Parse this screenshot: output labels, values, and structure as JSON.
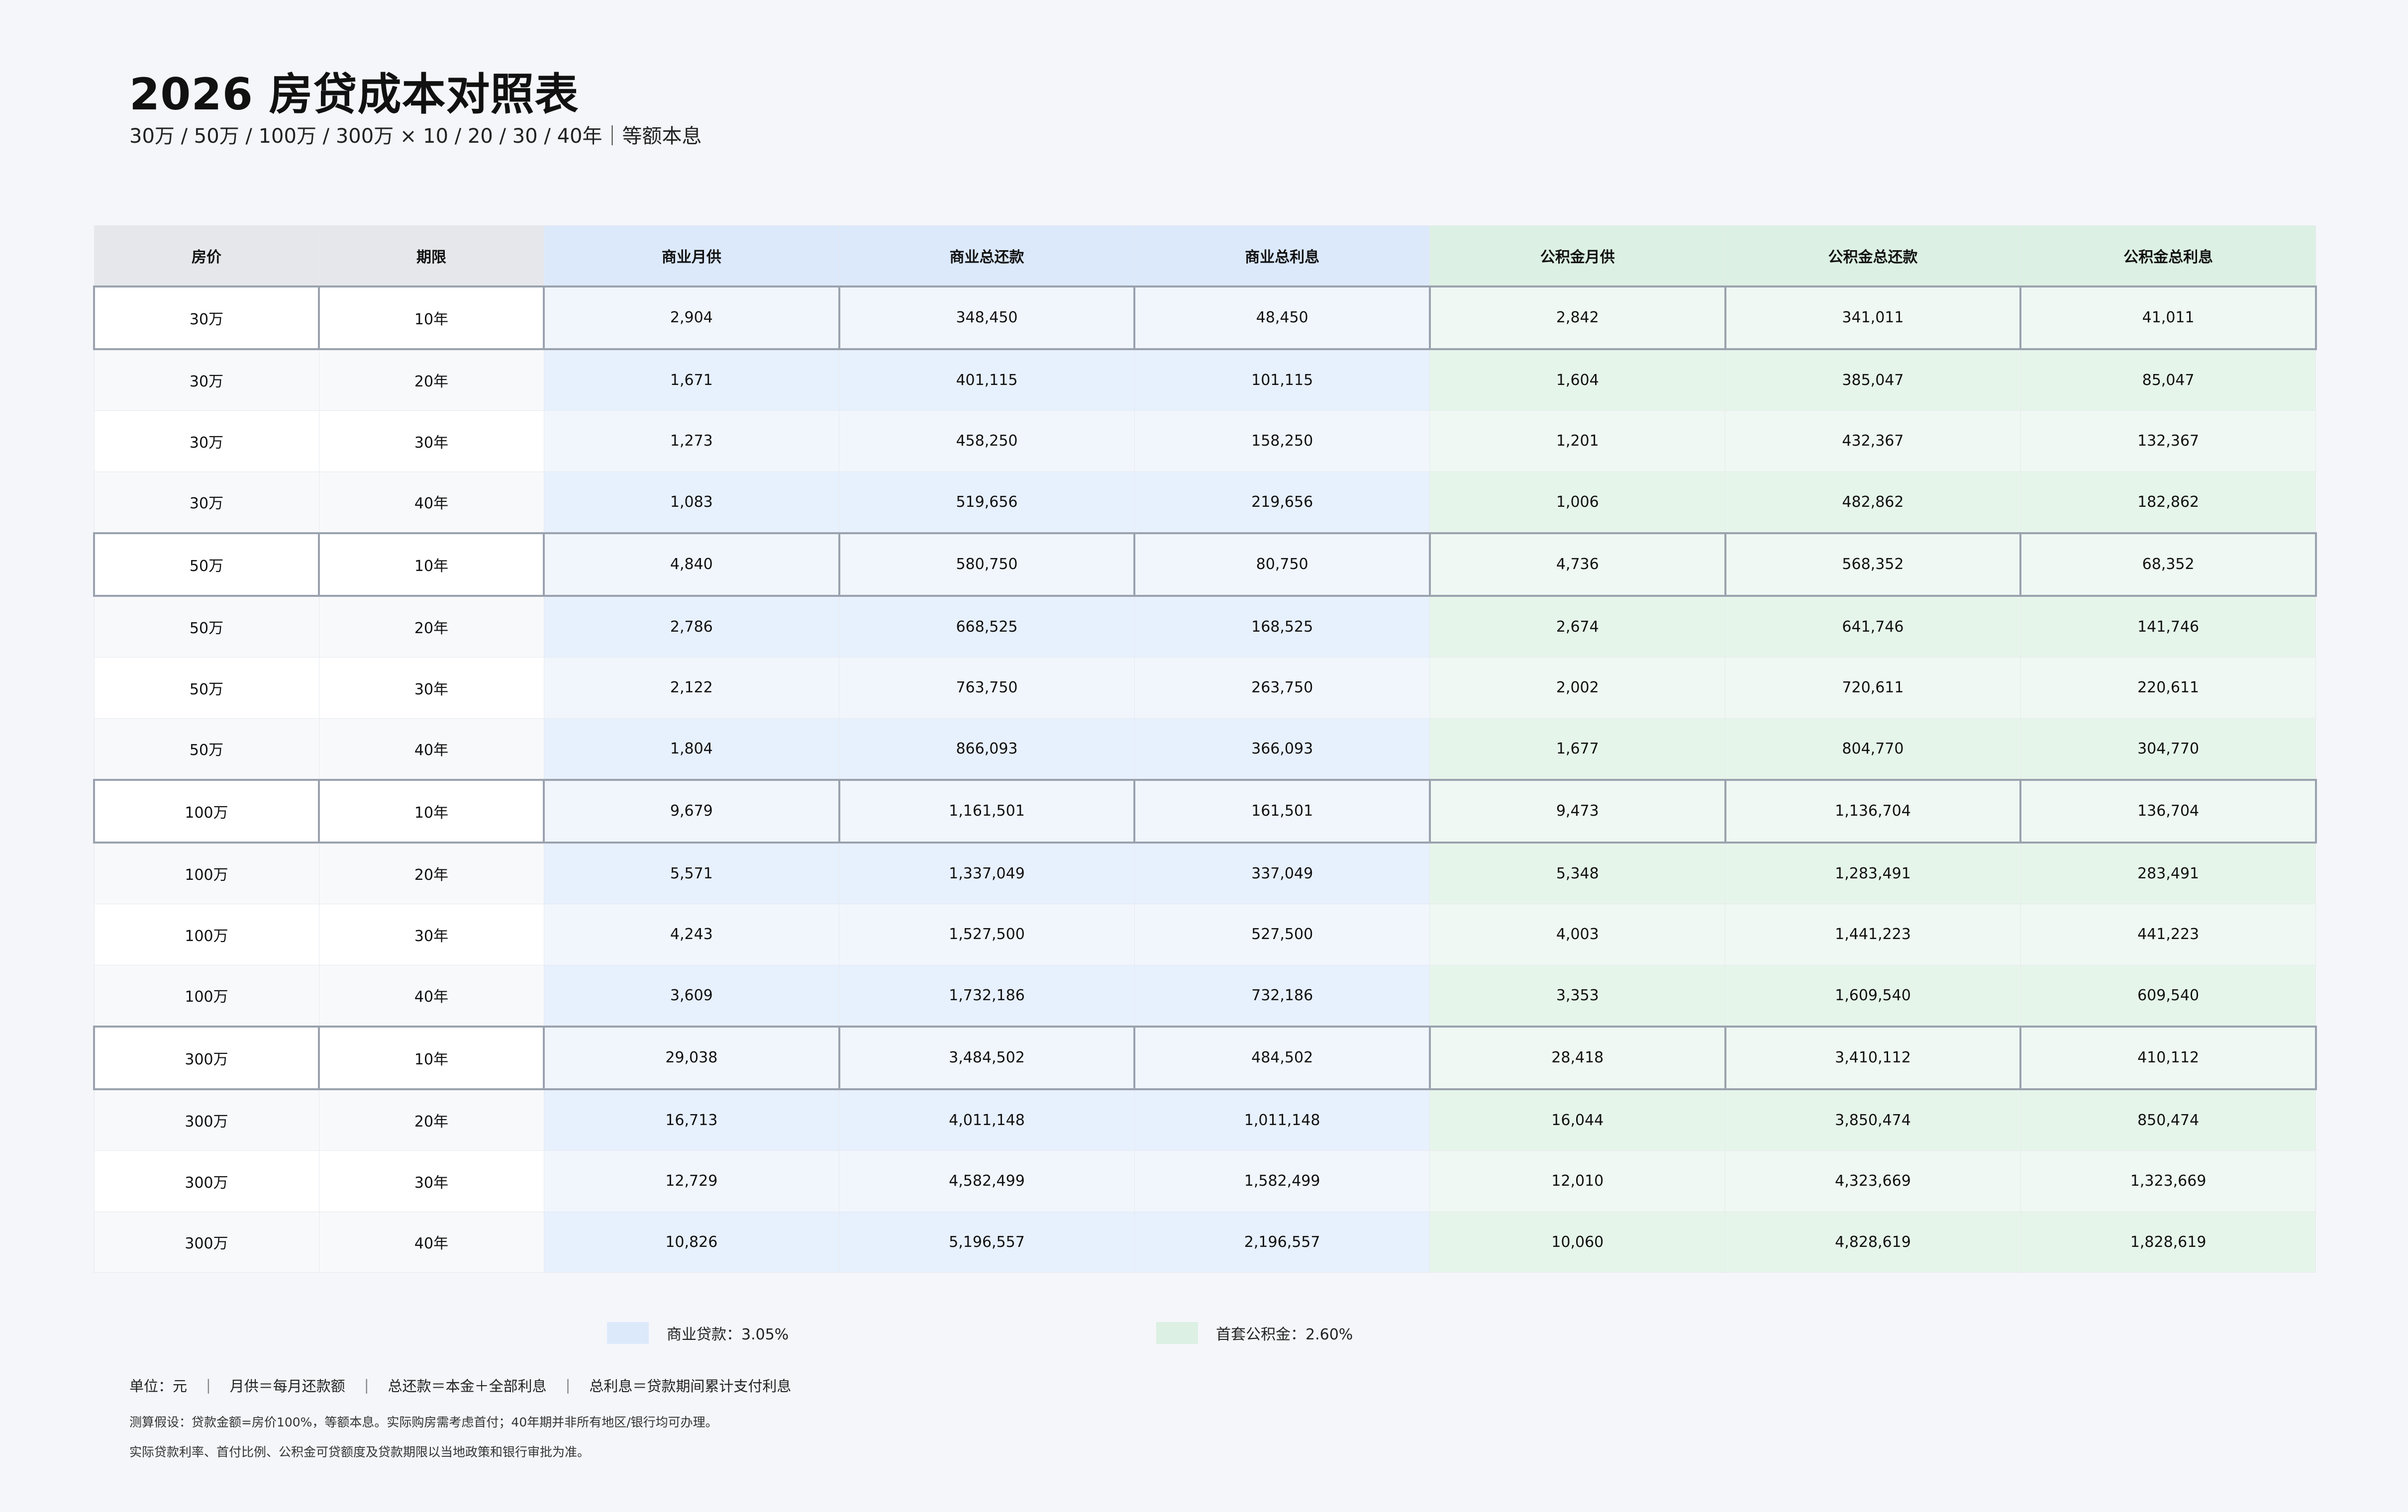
{
  "title": "2026 房贷成本对照表",
  "subtitle": "30万 / 50万 / 100万 / 300万 × 10 / 20 / 30 / 40年｜等额本息",
  "colors": {
    "commercial": "#dce9fb",
    "fund": "#dcf0e3",
    "header_grey": "#e6e7ea"
  },
  "table": {
    "headers": [
      "房价",
      "期限",
      "商业月供",
      "商业总还款",
      "商业总利息",
      "公积金月供",
      "公积金总还款",
      "公积金总利息"
    ],
    "rows": [
      [
        "30万",
        "10年",
        "2,904",
        "348,450",
        "48,450",
        "2,842",
        "341,011",
        "41,011"
      ],
      [
        "30万",
        "20年",
        "1,671",
        "401,115",
        "101,115",
        "1,604",
        "385,047",
        "85,047"
      ],
      [
        "30万",
        "30年",
        "1,273",
        "458,250",
        "158,250",
        "1,201",
        "432,367",
        "132,367"
      ],
      [
        "30万",
        "40年",
        "1,083",
        "519,656",
        "219,656",
        "1,006",
        "482,862",
        "182,862"
      ],
      [
        "50万",
        "10年",
        "4,840",
        "580,750",
        "80,750",
        "4,736",
        "568,352",
        "68,352"
      ],
      [
        "50万",
        "20年",
        "2,786",
        "668,525",
        "168,525",
        "2,674",
        "641,746",
        "141,746"
      ],
      [
        "50万",
        "30年",
        "2,122",
        "763,750",
        "263,750",
        "2,002",
        "720,611",
        "220,611"
      ],
      [
        "50万",
        "40年",
        "1,804",
        "866,093",
        "366,093",
        "1,677",
        "804,770",
        "304,770"
      ],
      [
        "100万",
        "10年",
        "9,679",
        "1,161,501",
        "161,501",
        "9,473",
        "1,136,704",
        "136,704"
      ],
      [
        "100万",
        "20年",
        "5,571",
        "1,337,049",
        "337,049",
        "5,348",
        "1,283,491",
        "283,491"
      ],
      [
        "100万",
        "30年",
        "4,243",
        "1,527,500",
        "527,500",
        "4,003",
        "1,441,223",
        "441,223"
      ],
      [
        "100万",
        "40年",
        "3,609",
        "1,732,186",
        "732,186",
        "3,353",
        "1,609,540",
        "609,540"
      ],
      [
        "300万",
        "10年",
        "29,038",
        "3,484,502",
        "484,502",
        "28,418",
        "3,410,112",
        "410,112"
      ],
      [
        "300万",
        "20年",
        "16,713",
        "4,011,148",
        "1,011,148",
        "16,044",
        "3,850,474",
        "850,474"
      ],
      [
        "300万",
        "30年",
        "12,729",
        "4,582,499",
        "1,582,499",
        "12,010",
        "4,323,669",
        "1,323,669"
      ],
      [
        "300万",
        "40年",
        "10,826",
        "5,196,557",
        "2,196,557",
        "10,060",
        "4,828,619",
        "1,828,619"
      ]
    ]
  },
  "legend": {
    "commercial": "商业贷款：3.05%",
    "fund": "首套公积金：2.60%"
  },
  "notes": [
    "单位：元",
    "月供＝每月还款额",
    "总还款＝本金＋全部利息",
    "总利息＝贷款期间累计支付利息"
  ],
  "footnotes": [
    "测算假设：贷款金额=房价100%，等额本息。实际购房需考虑首付；40年期并非所有地区/银行均可办理。",
    "实际贷款利率、首付比例、公积金可贷额度及贷款期限以当地政策和银行审批为准。"
  ]
}
